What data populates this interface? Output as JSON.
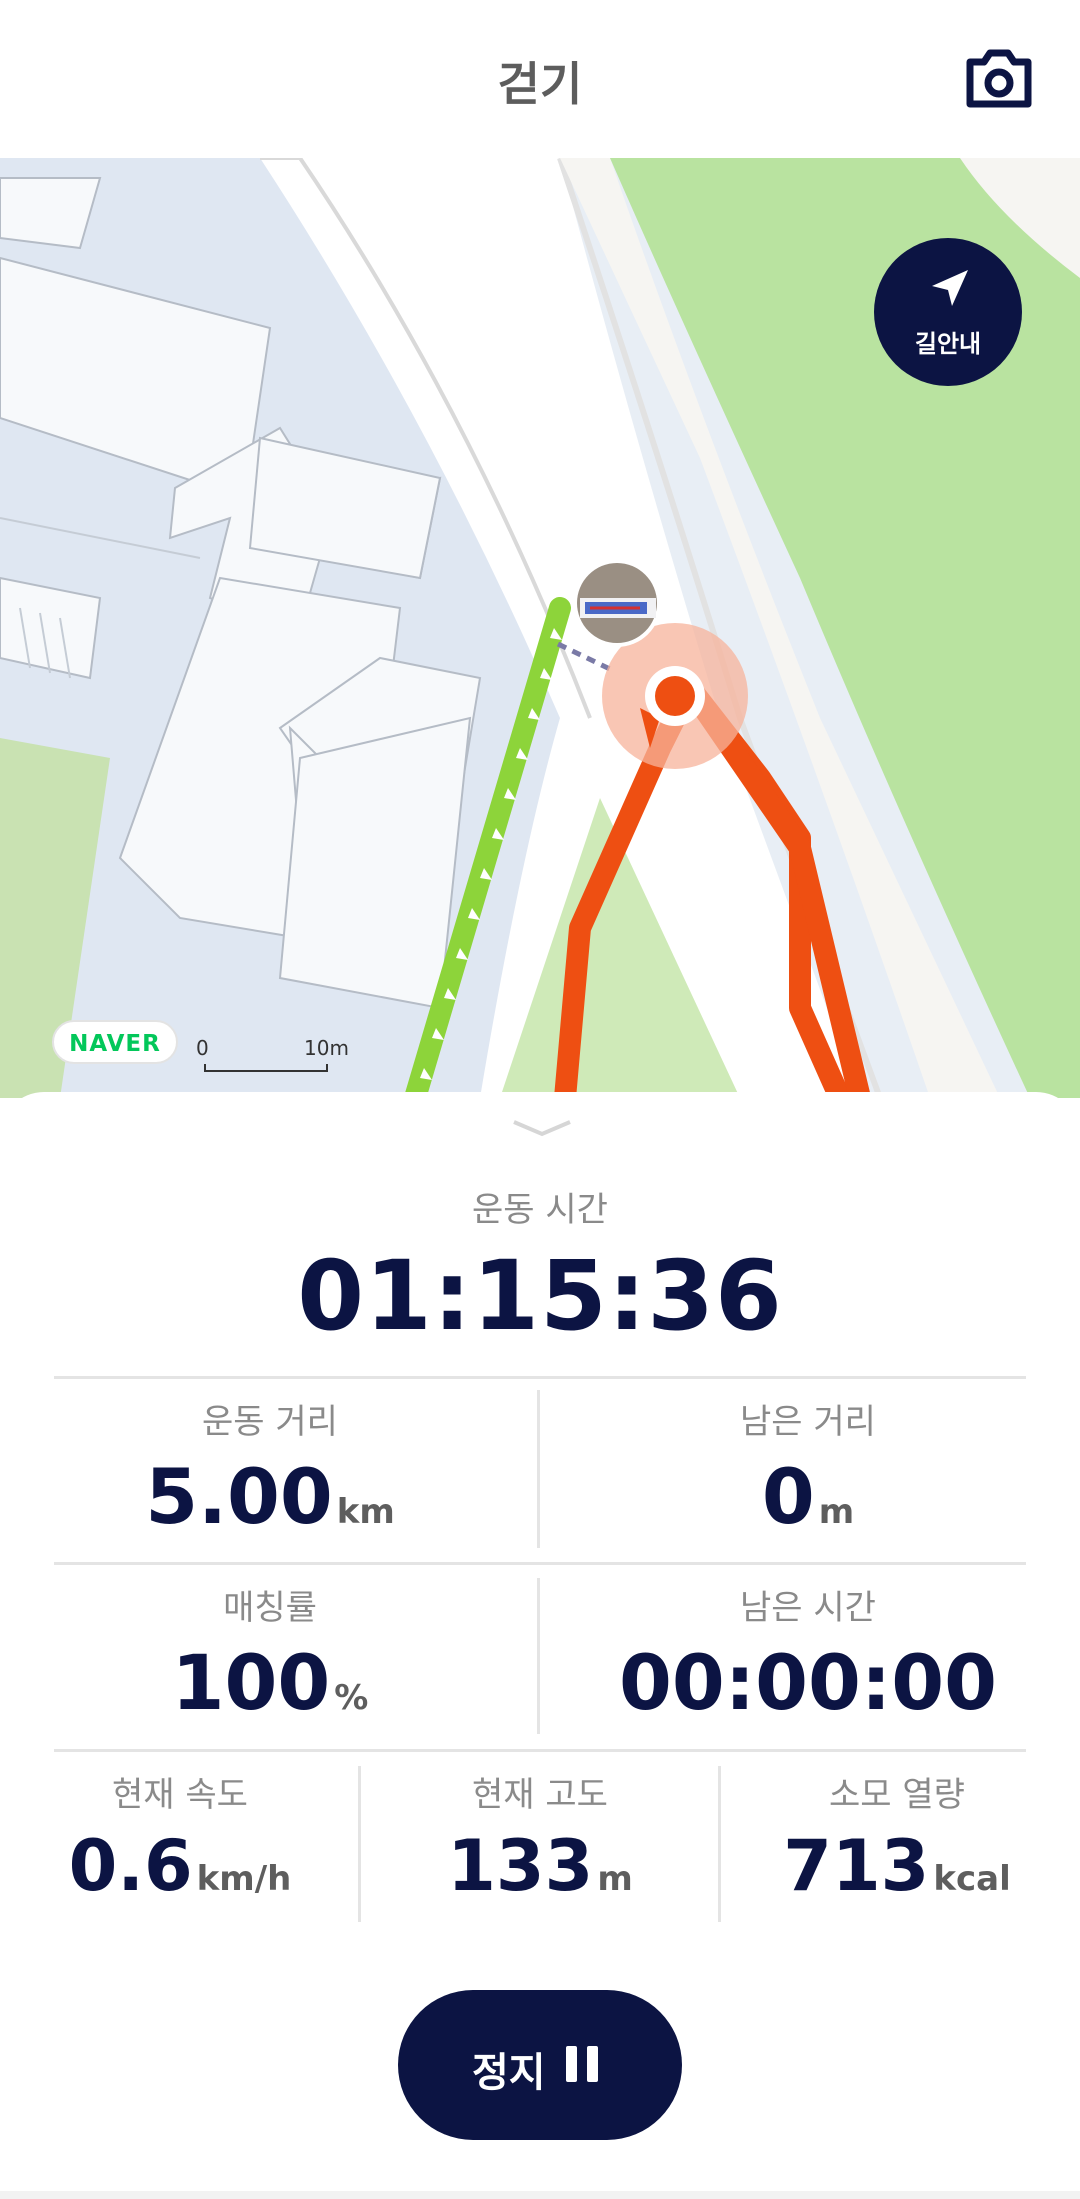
{
  "header": {
    "title": "걷기"
  },
  "map": {
    "nav_button_label": "길안내",
    "logo_text": "NAVER",
    "scale_start": "0",
    "scale_end": "10m"
  },
  "stats": {
    "time_label": "운동 시간",
    "time_value": "01:15:36",
    "distance_label": "운동 거리",
    "distance_value": "5.00",
    "distance_unit": "km",
    "remaining_distance_label": "남은 거리",
    "remaining_distance_value": "0",
    "remaining_distance_unit": "m",
    "matching_label": "매칭률",
    "matching_value": "100",
    "matching_unit": "%",
    "remaining_time_label": "남은 시간",
    "remaining_time_value": "00:00:00",
    "speed_label": "현재 속도",
    "speed_value": "0.6",
    "speed_unit": "km/h",
    "altitude_label": "현재 고도",
    "altitude_value": "133",
    "altitude_unit": "m",
    "calories_label": "소모 열량",
    "calories_value": "713",
    "calories_unit": "kcal"
  },
  "controls": {
    "stop_label": "정지"
  },
  "colors": {
    "navy": "#0c1443",
    "route": "#ee4f12",
    "guide": "#8dd43a",
    "park": "#b9e3a0"
  }
}
